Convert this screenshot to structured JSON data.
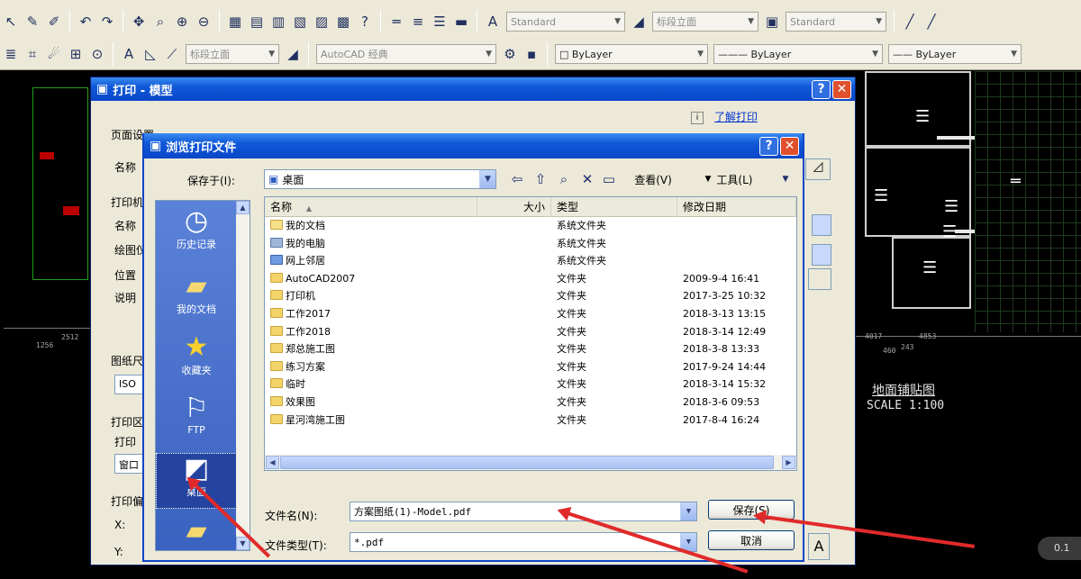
{
  "toolbar": {
    "row1": {
      "text_style": "Standard",
      "dim_style": "标段立面",
      "table_style": "Standard"
    },
    "row2": {
      "layer": "标段立面",
      "plot_style": "AutoCAD 经典",
      "color": "ByLayer",
      "linetype": "ByLayer",
      "lineweight": "ByLayer"
    }
  },
  "cad": {
    "title": "地面铺贴图",
    "scale": "SCALE 1:100",
    "dims": [
      "2512",
      "1256",
      "4017",
      "4853",
      "460",
      "243"
    ],
    "corner_badge": "0.1"
  },
  "plot_dialog": {
    "title": "打印 - 模型",
    "learn_link": "了解打印",
    "labels": {
      "page_setup": "页面设置",
      "name": "名称",
      "printer": "打印机",
      "printer_name": "名称",
      "plotter": "绘图仪",
      "location": "位置",
      "description": "说明",
      "paper_size": "图纸尺寸",
      "paper_value": "ISO",
      "plot_area": "打印区域",
      "plot_range": "打印",
      "window": "窗口",
      "plot_offset": "打印偏移",
      "x": "X:",
      "y": "Y:"
    }
  },
  "save_dialog": {
    "title": "浏览打印文件",
    "save_in_label": "保存于(I):",
    "save_in_value": "桌面",
    "view_menu": "查看(V)",
    "tools_menu": "工具(L)",
    "places": [
      "历史记录",
      "我的文档",
      "收藏夹",
      "FTP",
      "桌面"
    ],
    "columns": [
      "名称",
      "大小",
      "类型",
      "修改日期"
    ],
    "files": [
      {
        "name": "我的文档",
        "size": "",
        "type": "系统文件夹",
        "date": "",
        "icon": "system-folder"
      },
      {
        "name": "我的电脑",
        "size": "",
        "type": "系统文件夹",
        "date": "",
        "icon": "computer"
      },
      {
        "name": "网上邻居",
        "size": "",
        "type": "系统文件夹",
        "date": "",
        "icon": "network"
      },
      {
        "name": "AutoCAD2007",
        "size": "",
        "type": "文件夹",
        "date": "2009-9-4 16:41",
        "icon": "folder"
      },
      {
        "name": "打印机",
        "size": "",
        "type": "文件夹",
        "date": "2017-3-25 10:32",
        "icon": "folder"
      },
      {
        "name": "工作2017",
        "size": "",
        "type": "文件夹",
        "date": "2018-3-13 13:15",
        "icon": "folder"
      },
      {
        "name": "工作2018",
        "size": "",
        "type": "文件夹",
        "date": "2018-3-14 12:49",
        "icon": "folder"
      },
      {
        "name": "郑总施工图",
        "size": "",
        "type": "文件夹",
        "date": "2018-3-8 13:33",
        "icon": "folder"
      },
      {
        "name": "练习方案",
        "size": "",
        "type": "文件夹",
        "date": "2017-9-24 14:44",
        "icon": "folder"
      },
      {
        "name": "临时",
        "size": "",
        "type": "文件夹",
        "date": "2018-3-14 15:32",
        "icon": "folder"
      },
      {
        "name": "效果图",
        "size": "",
        "type": "文件夹",
        "date": "2018-3-6 09:53",
        "icon": "folder"
      },
      {
        "name": "星河湾施工图",
        "size": "",
        "type": "文件夹",
        "date": "2017-8-4 16:24",
        "icon": "folder"
      }
    ],
    "filename_label": "文件名(N):",
    "filename_value": "方案图纸(1)-Model.pdf",
    "filetype_label": "文件类型(T):",
    "filetype_value": "*.pdf",
    "save_button": "保存(S)",
    "cancel_button": "取消"
  },
  "colors": {
    "annotation_arrow": "#e02a2a",
    "title_bar": "#0a46c8"
  }
}
